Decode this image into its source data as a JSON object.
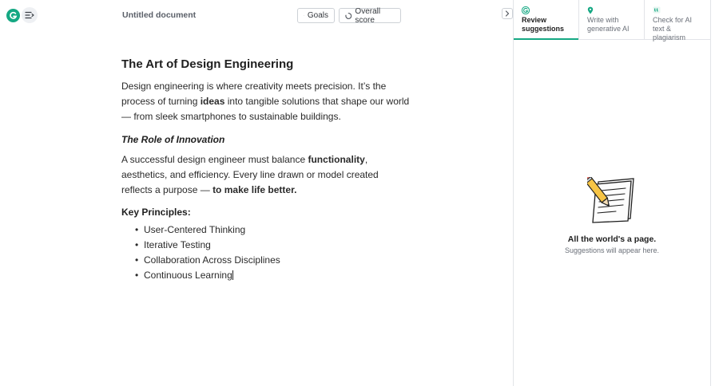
{
  "header": {
    "doc_title": "Untitled document",
    "goals_label": "Goals",
    "score_label": "Overall score"
  },
  "document": {
    "title": "The Art of Design Engineering",
    "para1": {
      "a": "Design engineering is where creativity meets precision. It’s the process of turning ",
      "b": "ideas",
      "c": " into tangible solutions that shape our world — from sleek smartphones to sustainable buildings."
    },
    "subtitle": "The Role of Innovation",
    "para2": {
      "a": "A successful design engineer must balance ",
      "b": "functionality",
      "c": ", aesthetics, and efficiency. Every line drawn or model created reflects a purpose — ",
      "d": "to make life better."
    },
    "principles_heading": "Key Principles:",
    "principles": [
      "User-Centered Thinking",
      "Iterative Testing",
      "Collaboration Across Disciplines",
      "Continuous Learning"
    ]
  },
  "panel": {
    "tabs": [
      {
        "label": "Review suggestions",
        "icon": "grammarly-logo-icon",
        "active": true
      },
      {
        "label": "Write with generative AI",
        "icon": "ai-pin-icon",
        "active": false
      },
      {
        "label": "Check for AI text & plagiarism",
        "icon": "quote-icon",
        "active": false
      }
    ],
    "empty_title": "All the world's a page.",
    "empty_subtitle": "Suggestions will appear here."
  },
  "colors": {
    "brand": "#15a883",
    "text": "#1f1f1f",
    "muted": "#6b7079",
    "border": "#e2e4e8"
  }
}
